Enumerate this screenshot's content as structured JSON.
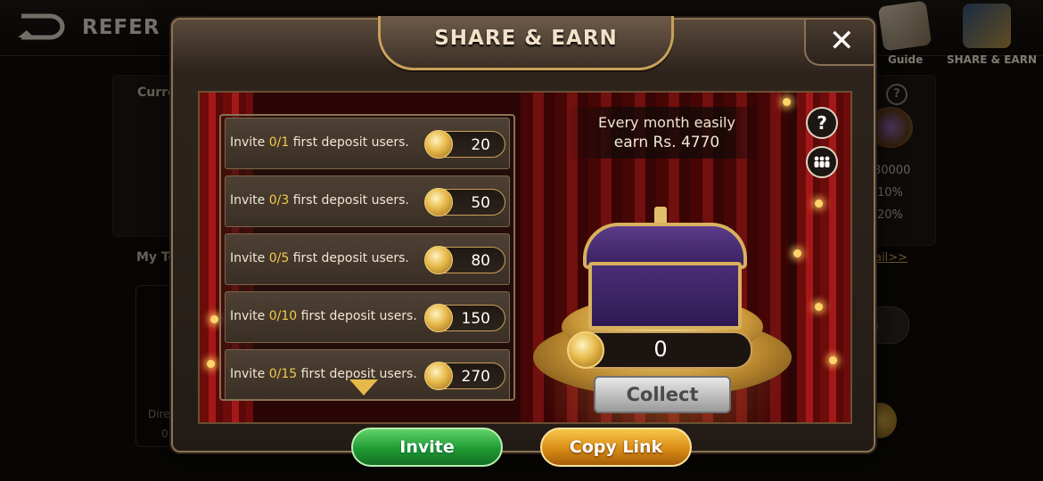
{
  "background": {
    "title": "REFER &",
    "nav": {
      "guide_label": "Guide",
      "share_label": "SHARE & EARN"
    },
    "labels": {
      "current": "Curre",
      "my_team": "My Te",
      "direct": "Dire",
      "zero": "0",
      "help": "?",
      "detail": "tail>>",
      "button_partial": "m"
    },
    "stats": [
      "30000",
      "10%",
      "20%"
    ]
  },
  "modal": {
    "title": "SHARE & EARN",
    "close_glyph": "✕",
    "tasks": [
      {
        "prefix": "Invite ",
        "progress": "0/1",
        "suffix": " first deposit users.",
        "reward": "20"
      },
      {
        "prefix": "Invite ",
        "progress": "0/3",
        "suffix": " first deposit users.",
        "reward": "50"
      },
      {
        "prefix": "Invite ",
        "progress": "0/5",
        "suffix": " first deposit users.",
        "reward": "80"
      },
      {
        "prefix": "Invite ",
        "progress": "0/10",
        "suffix": " first deposit users.",
        "reward": "150"
      },
      {
        "prefix": "Invite ",
        "progress": "0/15",
        "suffix": " first deposit users.",
        "reward": "270"
      }
    ],
    "earn": {
      "line1": "Every month easily",
      "line2": "earn Rs. 4770"
    },
    "help_glyph": "?",
    "chest_amount": "0",
    "collect_label": "Collect",
    "invite_label": "Invite",
    "copy_link_label": "Copy Link"
  },
  "colors": {
    "highlight": "#f3c94a",
    "accent_gold": "#c9a05a",
    "invite_green": "#1f9a32",
    "copy_orange": "#d98c14"
  },
  "icons": [
    "back-icon",
    "close-icon",
    "coin-icon",
    "help-icon",
    "team-icon",
    "chest-icon",
    "arrow-down-icon"
  ]
}
